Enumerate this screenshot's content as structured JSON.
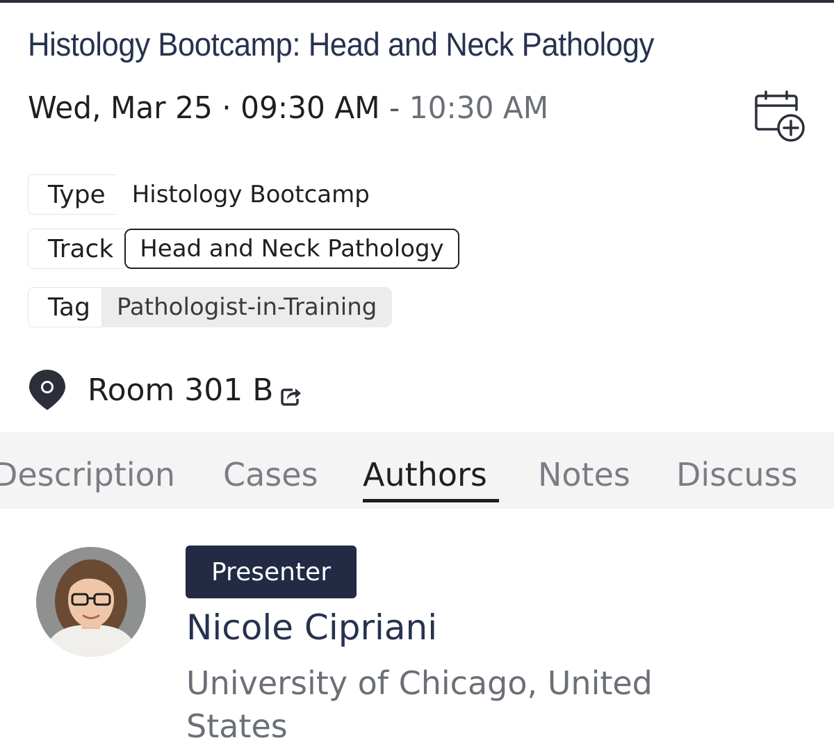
{
  "session": {
    "title": "Histology Bootcamp: Head and Neck Pathology",
    "date_start": "Wed, Mar 25 · 09:30 AM",
    "separator": "-",
    "end_time": "10:30 AM"
  },
  "meta": {
    "type_label": "Type",
    "type_value": "Histology Bootcamp",
    "track_label": "Track",
    "track_value": "Head and Neck Pathology",
    "tag_label": "Tag",
    "tag_value": "Pathologist-in-Training"
  },
  "location": {
    "room": "Room 301 B"
  },
  "tabs": [
    {
      "label": "Description"
    },
    {
      "label": "Cases"
    },
    {
      "label": "Authors",
      "active": true
    },
    {
      "label": "Notes"
    },
    {
      "label": "Discuss"
    }
  ],
  "author": {
    "role": "Presenter",
    "name": "Nicole Cipriani",
    "affiliation": "University of Chicago, United States"
  },
  "colors": {
    "title": "#27324f",
    "badge_bg": "#222a44",
    "tabbar_bg": "#f4f4f5",
    "muted_text": "#6b6f76"
  },
  "icons": [
    "calendar-add-icon",
    "location-pin-icon",
    "share-icon"
  ]
}
